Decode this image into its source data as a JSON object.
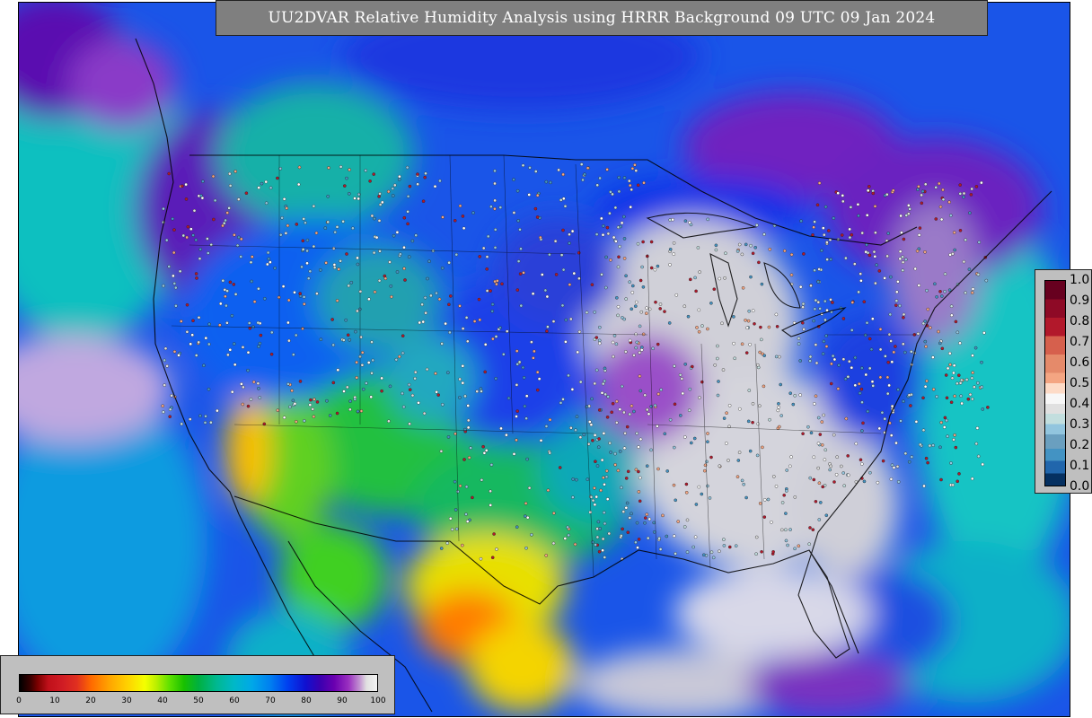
{
  "title": "UU2DVAR Relative Humidity Analysis using HRRR Background 09 UTC 09 Jan 2024",
  "station_colorbar": {
    "ticks": [
      "1.0",
      "0.9",
      "0.8",
      "0.7",
      "0.6",
      "0.5",
      "0.4",
      "0.3",
      "0.2",
      "0.1",
      "0.0"
    ]
  },
  "humidity_colorbar": {
    "ticks": [
      "0",
      "10",
      "20",
      "30",
      "40",
      "50",
      "60",
      "70",
      "80",
      "90",
      "100"
    ]
  },
  "colors": {
    "panel_gray": "#bfbfbf",
    "title_bg": "#7f7f7f",
    "dry_red": "#d01c24",
    "yellow": "#ffd000",
    "green": "#18c000",
    "cyan": "#00b8c8",
    "blue": "#0040f0",
    "purple": "#6a00b0",
    "saturated_gray": "#d6d6d6"
  }
}
